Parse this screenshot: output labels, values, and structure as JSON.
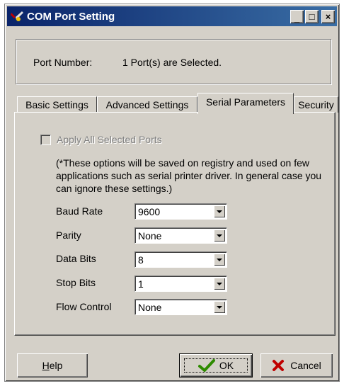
{
  "window": {
    "title": "COM Port Setting",
    "controls": {
      "minimize": "_",
      "maximize": "□",
      "close": "×"
    }
  },
  "port": {
    "label": "Port Number:",
    "value": "1 Port(s) are Selected."
  },
  "tabs": [
    {
      "label": "Basic Settings",
      "active": false
    },
    {
      "label": "Advanced Settings",
      "active": false
    },
    {
      "label": "Serial Parameters",
      "active": true
    },
    {
      "label": "Security",
      "active": false
    }
  ],
  "serial": {
    "apply_all_label": "Apply All Selected Ports",
    "apply_all_checked": false,
    "apply_all_enabled": false,
    "note": "(*These options will be saved on registry and used on few applications such as serial printer driver. In general case you can ignore these settings.)",
    "params": [
      {
        "label": "Baud Rate",
        "value": "9600"
      },
      {
        "label": "Parity",
        "value": "None"
      },
      {
        "label": "Data Bits",
        "value": "8"
      },
      {
        "label": "Stop Bits",
        "value": "1"
      },
      {
        "label": "Flow Control",
        "value": "None"
      }
    ]
  },
  "buttons": {
    "help": {
      "mnemonic": "H",
      "rest": "elp"
    },
    "ok": {
      "label": "OK",
      "icon": "check-icon",
      "color": "#2e8b00"
    },
    "cancel": {
      "label": "Cancel",
      "icon": "x-icon",
      "color": "#c00000"
    }
  }
}
